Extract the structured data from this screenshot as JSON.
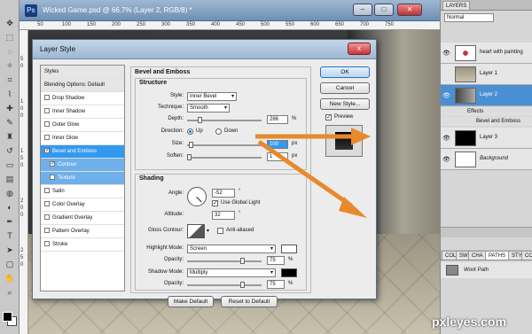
{
  "document": {
    "title": "Wicked Game.psd @ 66.7% (Layer 2, RGB/8) *",
    "app_icon": "Ps",
    "ruler_ticks": [
      "50",
      "100",
      "150",
      "200",
      "250",
      "300",
      "350",
      "400",
      "450",
      "500",
      "550",
      "600",
      "650",
      "700",
      "750"
    ],
    "vertical_ticks": [
      "5",
      "0",
      "1",
      "0",
      "0",
      "1",
      "5",
      "0",
      "2",
      "0",
      "0",
      "2",
      "5",
      "0"
    ]
  },
  "dialog": {
    "title": "Layer Style",
    "close_label": "x",
    "styles_list": [
      {
        "label": "Styles",
        "type": "header"
      },
      {
        "label": "Blending Options: Default",
        "type": "header"
      },
      {
        "label": "Drop Shadow",
        "checked": false
      },
      {
        "label": "Inner Shadow",
        "checked": false
      },
      {
        "label": "Outer Glow",
        "checked": false
      },
      {
        "label": "Inner Glow",
        "checked": false
      },
      {
        "label": "Bevel and Emboss",
        "checked": true,
        "selected": true
      },
      {
        "label": "Contour",
        "checked": true,
        "sub": true
      },
      {
        "label": "Texture",
        "checked": false,
        "sub": true
      },
      {
        "label": "Satin",
        "checked": false
      },
      {
        "label": "Color Overlay",
        "checked": false
      },
      {
        "label": "Gradient Overlay",
        "checked": false
      },
      {
        "label": "Pattern Overlay",
        "checked": false
      },
      {
        "label": "Stroke",
        "checked": false
      }
    ],
    "section_title": "Bevel and Emboss",
    "structure": {
      "title": "Structure",
      "style_label": "Style:",
      "style_value": "Inner Bevel",
      "technique_label": "Technique:",
      "technique_value": "Smooth",
      "depth_label": "Depth:",
      "depth_value": "286",
      "depth_unit": "%",
      "direction_label": "Direction:",
      "direction_up": "Up",
      "direction_down": "Down",
      "size_label": "Size:",
      "size_value": "100",
      "size_unit": "px",
      "soften_label": "Soften:",
      "soften_value": "1",
      "soften_unit": "px"
    },
    "shading": {
      "title": "Shading",
      "angle_label": "Angle:",
      "angle_value": "-52",
      "angle_unit": "°",
      "global_light_label": "Use Global Light",
      "altitude_label": "Altitude:",
      "altitude_value": "32",
      "altitude_unit": "°",
      "gloss_label": "Gloss Contour:",
      "antialiased_label": "Anti-aliased",
      "highlight_label": "Highlight Mode:",
      "highlight_value": "Screen",
      "highlight_opacity_label": "Opacity:",
      "highlight_opacity_value": "75",
      "highlight_opacity_unit": "%",
      "shadow_label": "Shadow Mode:",
      "shadow_value": "Multiply",
      "shadow_opacity_label": "Opacity:",
      "shadow_opacity_value": "75",
      "shadow_opacity_unit": "%"
    },
    "buttons": {
      "make_default": "Make Default",
      "reset_default": "Reset to Default",
      "ok": "OK",
      "cancel": "Cancel",
      "new_style": "New Style...",
      "preview": "Preview"
    }
  },
  "layers_panel": {
    "tab": "LAYERS",
    "blend_mode": "Normal",
    "layers": [
      {
        "name": "heart with painting",
        "selected": false,
        "italic": false
      },
      {
        "name": "Layer 1",
        "selected": false,
        "italic": false
      },
      {
        "name": "Layer 2",
        "selected": true,
        "italic": false
      },
      {
        "name": "Layer 3",
        "selected": false,
        "italic": false
      },
      {
        "name": "Background",
        "selected": false,
        "italic": true
      }
    ],
    "effects_label": "Effects",
    "effect_item": "Bevel and Emboss",
    "paths_tabs": [
      "COL",
      "SW",
      "CHA",
      "PATHS",
      "STY",
      "CO"
    ],
    "path_name": "Work Path"
  },
  "watermark": "pxleyes.com",
  "colors": {
    "accent": "#3399ee",
    "arrow": "#e8892c"
  }
}
